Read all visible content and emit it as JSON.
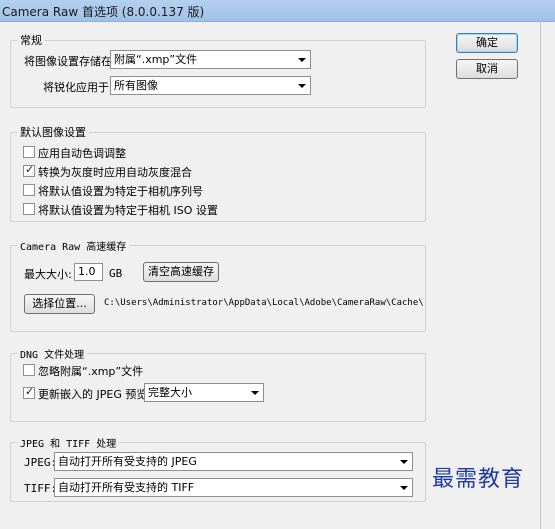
{
  "window": {
    "title": "Camera Raw 首选项 (8.0.0.137 版)"
  },
  "buttons": {
    "ok": "确定",
    "cancel": "取消"
  },
  "general": {
    "legend": "常规",
    "save_label": "将图像设置存储在:",
    "save_value": "附属“.xmp”文件",
    "sharpen_label": "将锐化应用于:",
    "sharpen_value": "所有图像"
  },
  "defaults": {
    "legend": "默认图像设置",
    "options": [
      {
        "label": "应用自动色调调整",
        "checked": false
      },
      {
        "label": "转换为灰度时应用自动灰度混合",
        "checked": true
      },
      {
        "label": "将默认值设置为特定于相机序列号",
        "checked": false
      },
      {
        "label": "将默认值设置为特定于相机 ISO 设置",
        "checked": false
      }
    ]
  },
  "cache": {
    "legend": "Camera Raw 高速缓存",
    "max_size_label": "最大大小:",
    "max_size_value": "1.0",
    "unit": "GB",
    "purge_button": "清空高速缓存",
    "location_button": "选择位置...",
    "path": "C:\\Users\\Administrator\\AppData\\Local\\Adobe\\CameraRaw\\Cache\\"
  },
  "dng": {
    "legend": "DNG 文件处理",
    "ignore_label": "忽略附属“.xmp”文件",
    "ignore_checked": false,
    "update_label": "更新嵌入的 JPEG 预览:",
    "update_checked": true,
    "preview_value": "完整大小"
  },
  "jpeg_tiff": {
    "legend": "JPEG 和 TIFF 处理",
    "jpeg_label": "JPEG:",
    "jpeg_value": "自动打开所有受支持的 JPEG",
    "tiff_label": "TIFF:",
    "tiff_value": "自动打开所有受支持的 TIFF"
  },
  "watermark": "最需教育"
}
